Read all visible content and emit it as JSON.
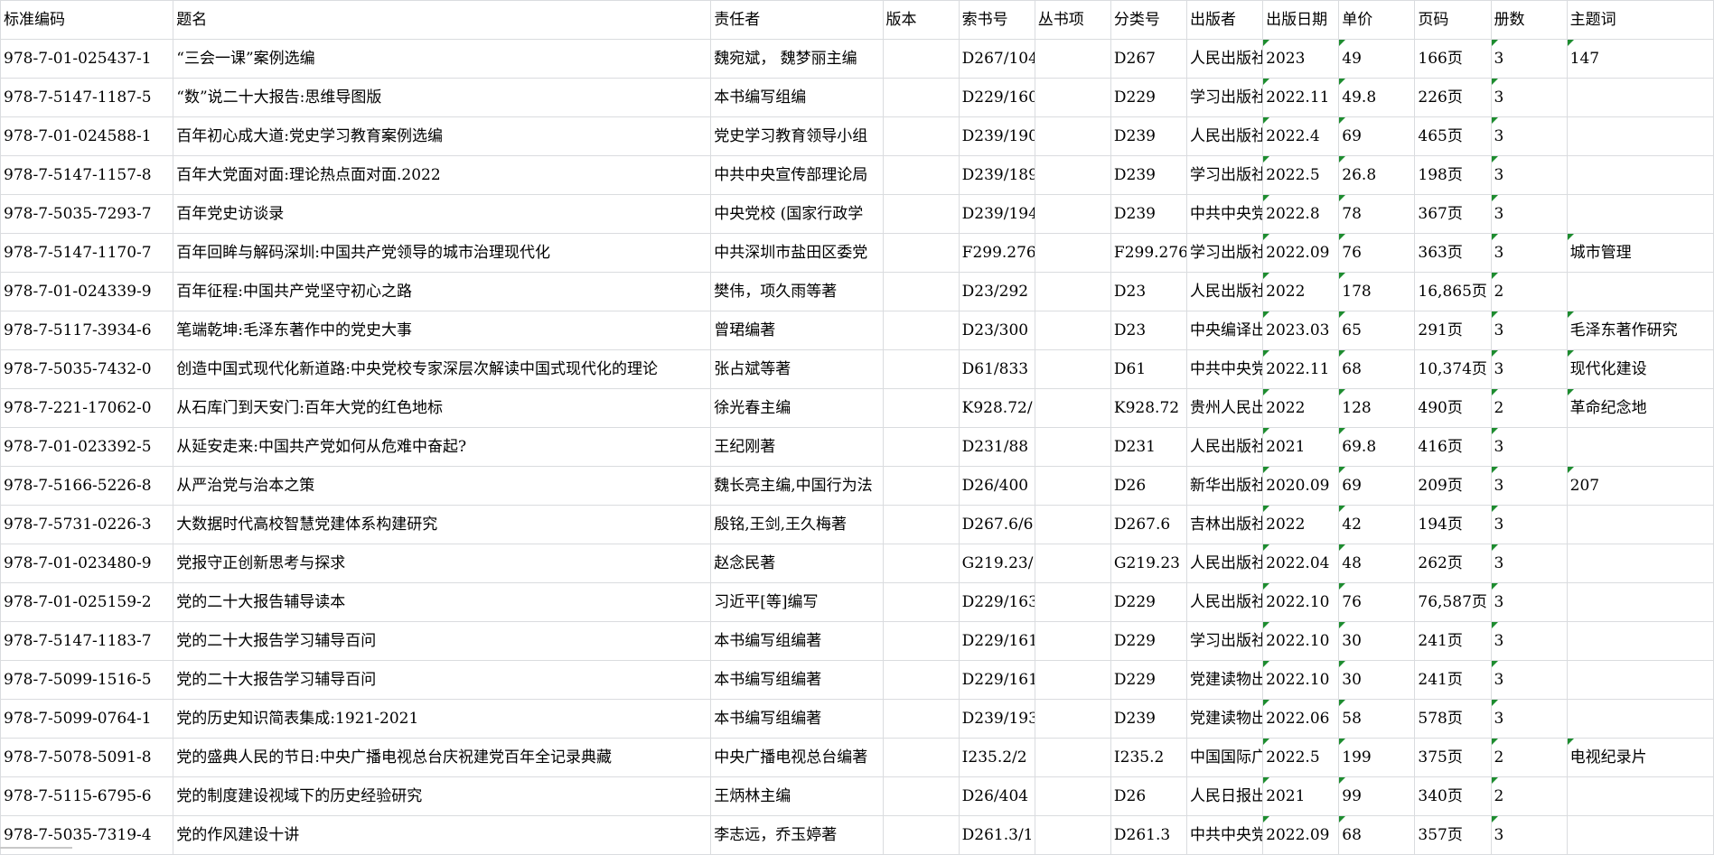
{
  "sheet": {
    "columns": [
      "标准编码",
      "题名",
      "责任者",
      "版本",
      "索书号",
      "丛书项",
      "分类号",
      "出版者",
      "出版日期",
      "单价",
      "页码",
      "册数",
      "主题词"
    ],
    "rows": [
      [
        "978-7-01-025437-1",
        "“三会一课”案例选编",
        "魏宛斌， 魏梦丽主编",
        "",
        "D267/104",
        "",
        "D267",
        "人民出版社",
        "2023",
        "49",
        "166页",
        "3",
        "147"
      ],
      [
        "978-7-5147-1187-5",
        "“数”说二十大报告:思维导图版",
        "本书编写组编",
        "",
        "D229/160",
        "",
        "D229",
        "学习出版社",
        "2022.11",
        "49.8",
        "226页",
        "3",
        ""
      ],
      [
        "978-7-01-024588-1",
        "百年初心成大道:党史学习教育案例选编",
        "党史学习教育领导小组",
        "",
        "D239/190",
        "",
        "D239",
        "人民出版社",
        "2022.4",
        "69",
        "465页",
        "3",
        ""
      ],
      [
        "978-7-5147-1157-8",
        "百年大党面对面:理论热点面对面.2022",
        "中共中央宣传部理论局",
        "",
        "D239/189",
        "",
        "D239",
        "学习出版社",
        "2022.5",
        "26.8",
        "198页",
        "3",
        ""
      ],
      [
        "978-7-5035-7293-7",
        "百年党史访谈录",
        "中央党校 (国家行政学",
        "",
        "D239/194",
        "",
        "D239",
        "中共中央党",
        "2022.8",
        "78",
        "367页",
        "3",
        ""
      ],
      [
        "978-7-5147-1170-7",
        "百年回眸与解码深圳:中国共产党领导的城市治理现代化",
        "中共深圳市盐田区委党",
        "",
        "F299.276",
        "",
        "F299.276",
        "学习出版社",
        "2022.09",
        "76",
        "363页",
        "3",
        "城市管理"
      ],
      [
        "978-7-01-024339-9",
        "百年征程:中国共产党坚守初心之路",
        "樊伟，项久雨等著",
        "",
        "D23/292",
        "",
        "D23",
        "人民出版社",
        "2022",
        "178",
        "16,865页",
        "2",
        ""
      ],
      [
        "978-7-5117-3934-6",
        "笔端乾坤:毛泽东著作中的党史大事",
        "曾珺编著",
        "",
        "D23/300",
        "",
        "D23",
        "中央编译出",
        "2023.03",
        "65",
        "291页",
        "3",
        "毛泽东著作研究"
      ],
      [
        "978-7-5035-7432-0",
        "创造中国式现代化新道路:中央党校专家深层次解读中国式现代化的理论",
        "张占斌等著",
        "",
        "D61/833",
        "",
        "D61",
        "中共中央党",
        "2022.11",
        "68",
        "10,374页",
        "3",
        "现代化建设"
      ],
      [
        "978-7-221-17062-0",
        "从石库门到天安门:百年大党的红色地标",
        "徐光春主编",
        "",
        "K928.72/",
        "",
        "K928.72",
        "贵州人民出",
        "2022",
        "128",
        "490页",
        "2",
        "革命纪念地"
      ],
      [
        "978-7-01-023392-5",
        "从延安走来:中国共产党如何从危难中奋起?",
        "王纪刚著",
        "",
        "D231/88",
        "",
        "D231",
        "人民出版社",
        "2021",
        "69.8",
        "416页",
        "3",
        ""
      ],
      [
        "978-7-5166-5226-8",
        "从严治党与治本之策",
        "魏长亮主编,中国行为法",
        "",
        "D26/400",
        "",
        "D26",
        "新华出版社",
        "2020.09",
        "69",
        "209页",
        "3",
        "207"
      ],
      [
        "978-7-5731-0226-3",
        "大数据时代高校智慧党建体系构建研究",
        "殷铭,王剑,王久梅著",
        "",
        "D267.6/6",
        "",
        "D267.6",
        "吉林出版社",
        "2022",
        "42",
        "194页",
        "3",
        ""
      ],
      [
        "978-7-01-023480-9",
        "党报守正创新思考与探求",
        "赵念民著",
        "",
        "G219.23/",
        "",
        "G219.23",
        "人民出版社",
        "2022.04",
        "48",
        "262页",
        "3",
        ""
      ],
      [
        "978-7-01-025159-2",
        "党的二十大报告辅导读本",
        "习近平[等]编写",
        "",
        "D229/163",
        "",
        "D229",
        "人民出版社",
        "2022.10",
        "76",
        "76,587页",
        "3",
        ""
      ],
      [
        "978-7-5147-1183-7",
        "党的二十大报告学习辅导百问",
        "本书编写组编著",
        "",
        "D229/161",
        "",
        "D229",
        "学习出版社",
        "2022.10",
        "30",
        "241页",
        "3",
        ""
      ],
      [
        "978-7-5099-1516-5",
        "党的二十大报告学习辅导百问",
        "本书编写组编著",
        "",
        "D229/161",
        "",
        "D229",
        "党建读物出",
        "2022.10",
        "30",
        "241页",
        "3",
        ""
      ],
      [
        "978-7-5099-0764-1",
        "党的历史知识简表集成:1921-2021",
        "本书编写组编著",
        "",
        "D239/193",
        "",
        "D239",
        "党建读物出",
        "2022.06",
        "58",
        "578页",
        "3",
        ""
      ],
      [
        "978-7-5078-5091-8",
        "党的盛典人民的节日:中央广播电视总台庆祝建党百年全记录典藏",
        "中央广播电视总台编著",
        "",
        "I235.2/2",
        "",
        "I235.2",
        "中国国际广",
        "2022.5",
        "199",
        "375页",
        "2",
        "电视纪录片"
      ],
      [
        "978-7-5115-6795-6",
        "党的制度建设视域下的历史经验研究",
        "王炳林主编",
        "",
        "D26/404",
        "",
        "D26",
        "人民日报出",
        "2021",
        "99",
        "340页",
        "2",
        ""
      ],
      [
        "978-7-5035-7319-4",
        "党的作风建设十讲",
        "李志远，乔玉婷著",
        "",
        "D261.3/1",
        "",
        "D261.3",
        "中共中央党",
        "2022.09",
        "68",
        "357页",
        "3",
        ""
      ]
    ]
  }
}
